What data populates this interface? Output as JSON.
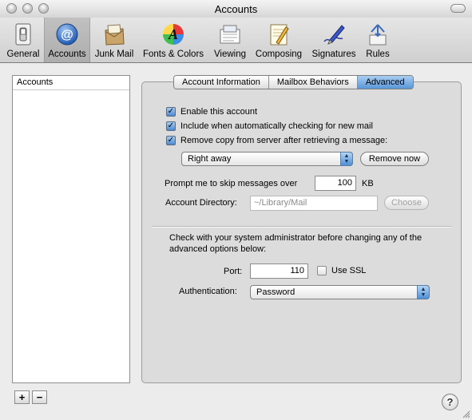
{
  "window": {
    "title": "Accounts"
  },
  "toolbar": {
    "items": [
      {
        "label": "General",
        "icon": "switch-icon"
      },
      {
        "label": "Accounts",
        "icon": "at-sign-icon",
        "selected": true
      },
      {
        "label": "Junk Mail",
        "icon": "junk-mail-icon"
      },
      {
        "label": "Fonts & Colors",
        "icon": "fonts-colors-icon"
      },
      {
        "label": "Viewing",
        "icon": "viewing-icon"
      },
      {
        "label": "Composing",
        "icon": "composing-icon"
      },
      {
        "label": "Signatures",
        "icon": "signatures-icon"
      },
      {
        "label": "Rules",
        "icon": "rules-icon"
      }
    ]
  },
  "sidebar": {
    "header": "Accounts",
    "add_label": "+",
    "remove_label": "−"
  },
  "tabs": {
    "items": [
      "Account Information",
      "Mailbox Behaviors",
      "Advanced"
    ],
    "active": "Advanced"
  },
  "advanced": {
    "enable_label": "Enable this account",
    "include_label": "Include when automatically checking for new mail",
    "remove_copy_label": "Remove copy from server after retrieving a message:",
    "remove_popup_value": "Right away",
    "remove_now_label": "Remove now",
    "prompt_label": "Prompt me to skip messages over",
    "prompt_value": "100",
    "prompt_unit": "KB",
    "dir_label": "Account Directory:",
    "dir_placeholder": "~/Library/Mail",
    "choose_label": "Choose",
    "notice": "Check with your system administrator before changing any of the advanced options below:",
    "port_label": "Port:",
    "port_value": "110",
    "ssl_label": "Use SSL",
    "auth_label": "Authentication:",
    "auth_value": "Password"
  },
  "help": {
    "label": "?"
  },
  "colors": {
    "accent": "#5a97d8",
    "selection": "#4c8ad0"
  }
}
